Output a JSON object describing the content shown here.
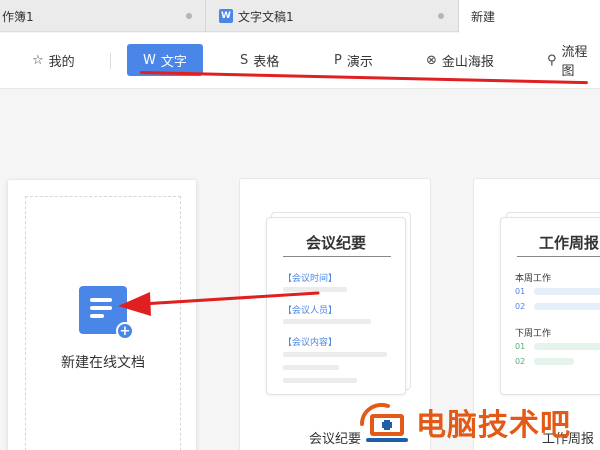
{
  "tabs": [
    {
      "label": "作簿1"
    },
    {
      "label": "文字文稿1",
      "icon": "W"
    },
    {
      "label": "新建"
    }
  ],
  "nav": {
    "items": [
      {
        "icon": "☆",
        "label": "我的"
      },
      {
        "icon": "W",
        "label": "文字"
      },
      {
        "icon": "S",
        "label": "表格"
      },
      {
        "icon": "P",
        "label": "演示"
      },
      {
        "icon": "⊗",
        "label": "金山海报"
      },
      {
        "icon": "⚲",
        "label": "流程图"
      }
    ]
  },
  "new_card": {
    "label": "新建在线文档"
  },
  "templates": [
    {
      "title": "会议纪要",
      "fields": [
        "【会议时间】",
        "【会议人员】",
        "【会议内容】"
      ],
      "caption": "会议纪要"
    },
    {
      "title": "工作周报",
      "sections": [
        {
          "label": "本周工作",
          "rows": [
            "01",
            "02"
          ]
        },
        {
          "label": "下周工作",
          "rows": [
            "01",
            "02"
          ]
        }
      ],
      "caption": "工作周报"
    }
  ],
  "watermark": {
    "text": "电脑技术吧"
  },
  "colors": {
    "accent": "#4a86e8",
    "annotation": "#e02020",
    "watermark": "#e25a16"
  }
}
